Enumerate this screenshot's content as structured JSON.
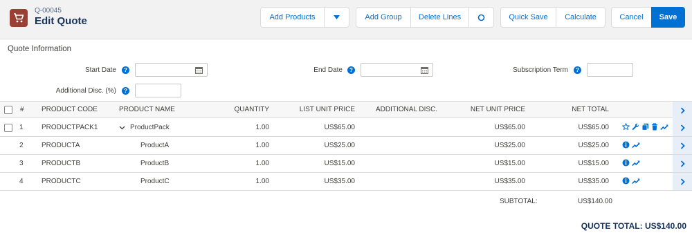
{
  "header": {
    "record_id": "Q-00045",
    "title": "Edit Quote",
    "buttons": {
      "add_products": "Add Products",
      "add_group": "Add Group",
      "delete_lines": "Delete Lines",
      "quick_save": "Quick Save",
      "calculate": "Calculate",
      "cancel": "Cancel",
      "save": "Save"
    }
  },
  "quote_info": {
    "section_title": "Quote Information",
    "start_date_label": "Start Date",
    "start_date_value": "",
    "end_date_label": "End Date",
    "end_date_value": "",
    "subscription_term_label": "Subscription Term",
    "subscription_term_value": "",
    "additional_disc_label": "Additional Disc. (%)",
    "additional_disc_value": ""
  },
  "table": {
    "columns": [
      "#",
      "PRODUCT CODE",
      "PRODUCT NAME",
      "QUANTITY",
      "LIST UNIT PRICE",
      "ADDITIONAL DISC.",
      "NET UNIT PRICE",
      "NET TOTAL"
    ],
    "rows": [
      {
        "num": "1",
        "code": "PRODUCTPACK1",
        "name": "ProductPack",
        "quantity": "1.00",
        "list_price": "US$65.00",
        "add_disc": "",
        "net_unit": "US$65.00",
        "net_total": "US$65.00"
      },
      {
        "num": "2",
        "code": "PRODUCTA",
        "name": "ProductA",
        "quantity": "1.00",
        "list_price": "US$25.00",
        "add_disc": "",
        "net_unit": "US$25.00",
        "net_total": "US$25.00"
      },
      {
        "num": "3",
        "code": "PRODUCTB",
        "name": "ProductB",
        "quantity": "1.00",
        "list_price": "US$15.00",
        "add_disc": "",
        "net_unit": "US$15.00",
        "net_total": "US$15.00"
      },
      {
        "num": "4",
        "code": "PRODUCTC",
        "name": "ProductC",
        "quantity": "1.00",
        "list_price": "US$35.00",
        "add_disc": "",
        "net_unit": "US$35.00",
        "net_total": "US$35.00"
      }
    ],
    "subtotal_label": "SUBTOTAL:",
    "subtotal_value": "US$140.00",
    "quote_total": "QUOTE TOTAL: US$140.00"
  },
  "icons": {
    "app": "shopping-cart-icon",
    "dropdown": "chevron-down-icon",
    "refresh": "circle-icon",
    "calendar": "calendar-icon",
    "help": "help-icon",
    "expand": "chevron-down-icon",
    "nav": "chevron-right-icon",
    "row_actions_bundle": [
      "star-icon",
      "wrench-icon",
      "copy-icon",
      "trash-icon",
      "trend-icon"
    ],
    "row_actions_line": [
      "info-icon",
      "trend-icon"
    ]
  },
  "colors": {
    "brand": "#0070d2",
    "app_icon_bg": "#9b3f34",
    "title": "#16325c",
    "header_bg": "#f3f2f2"
  }
}
